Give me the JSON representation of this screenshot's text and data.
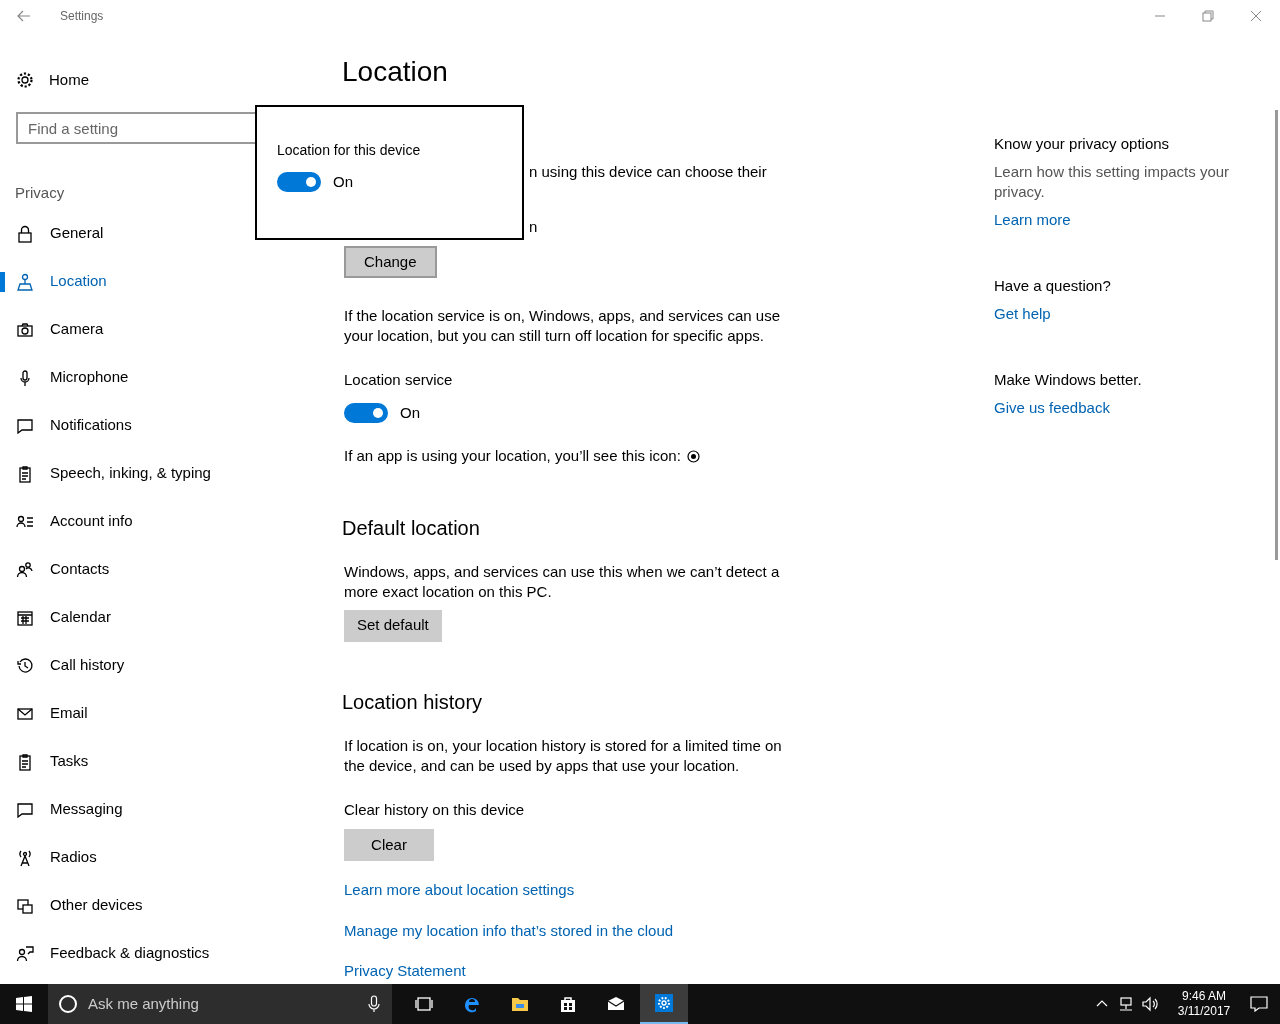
{
  "window": {
    "title": "Settings"
  },
  "sidebar": {
    "home": "Home",
    "search": {
      "placeholder": "Find a setting"
    },
    "section": "Privacy",
    "items": [
      {
        "label": "General",
        "selected": false
      },
      {
        "label": "Location",
        "selected": true
      },
      {
        "label": "Camera",
        "selected": false
      },
      {
        "label": "Microphone",
        "selected": false
      },
      {
        "label": "Notifications",
        "selected": false
      },
      {
        "label": "Speech, inking, & typing",
        "selected": false
      },
      {
        "label": "Account info",
        "selected": false
      },
      {
        "label": "Contacts",
        "selected": false
      },
      {
        "label": "Calendar",
        "selected": false
      },
      {
        "label": "Call history",
        "selected": false
      },
      {
        "label": "Email",
        "selected": false
      },
      {
        "label": "Tasks",
        "selected": false
      },
      {
        "label": "Messaging",
        "selected": false
      },
      {
        "label": "Radios",
        "selected": false
      },
      {
        "label": "Other devices",
        "selected": false
      },
      {
        "label": "Feedback & diagnostics",
        "selected": false
      }
    ]
  },
  "main": {
    "title": "Location",
    "device_text": "n using this device can choose their",
    "device_status": "n",
    "change_button": "Change",
    "service_description": "If the location service is on, Windows, apps, and services can use your location, but you can still turn off location for specific apps.",
    "service": {
      "label": "Location service",
      "on": true,
      "state_text": "On"
    },
    "icon_note": "If an app is using your location, you’ll see this icon:",
    "default_location": {
      "heading": "Default location",
      "text": "Windows, apps, and services can use this when we can’t detect a more exact location on this PC.",
      "button": "Set default"
    },
    "history": {
      "heading": "Location history",
      "text": "If location is on, your location history is stored for a limited time on the device, and can be used by apps that use your location.",
      "label": "Clear history on this device",
      "button": "Clear"
    },
    "links": [
      "Learn more about location settings",
      "Manage my location info that’s stored in the cloud",
      "Privacy Statement"
    ]
  },
  "popup": {
    "label": "Location for this device",
    "on": true,
    "state_text": "On"
  },
  "related": [
    {
      "heading": "Know your privacy options",
      "text": "Learn how this setting impacts your privacy.",
      "link": "Learn more"
    },
    {
      "heading": "Have a question?",
      "link": "Get help"
    },
    {
      "heading": "Make Windows better.",
      "link": "Give us feedback"
    }
  ],
  "taskbar": {
    "search_placeholder": "Ask me anything",
    "apps": [
      {
        "selected": false
      },
      {
        "selected": false
      },
      {
        "selected": false
      },
      {
        "selected": false
      },
      {
        "selected": false
      },
      {
        "selected": true
      }
    ],
    "time": "9:46 AM",
    "date": "3/11/2017"
  }
}
